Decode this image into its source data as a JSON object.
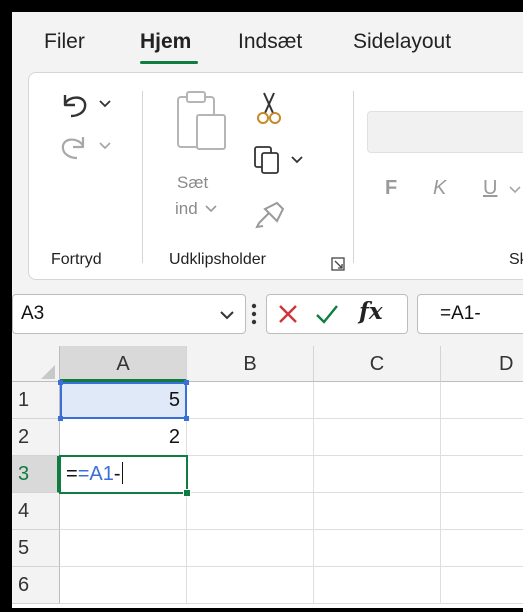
{
  "tabs": [
    {
      "label": "Filer"
    },
    {
      "label": "Hjem"
    },
    {
      "label": "Indsæt"
    },
    {
      "label": "Sidelayout"
    }
  ],
  "ribbon": {
    "undo_group_label": "Fortryd",
    "clipboard_group_label": "Udklipsholder",
    "paste_label_line1": "Sæt",
    "paste_label_line2": "ind",
    "bold_label": "F",
    "italic_label": "K",
    "underline_label": "U",
    "font_group_label_partial": "Sk"
  },
  "formula_bar": {
    "name_box": "A3",
    "fx_label": "fx",
    "formula": "=A1-"
  },
  "grid": {
    "columns": [
      "A",
      "B",
      "C",
      "D"
    ],
    "rows": [
      "1",
      "2",
      "3",
      "4",
      "5",
      "6"
    ],
    "cells": {
      "A1": "5",
      "A2": "2",
      "A3_ref": "=A1",
      "A3_op": "-"
    }
  },
  "colors": {
    "accent_green": "#107c41",
    "reference_blue": "#3a6fd8",
    "reference_fill": "#dfe9f8",
    "cancel_red": "#d13438"
  }
}
